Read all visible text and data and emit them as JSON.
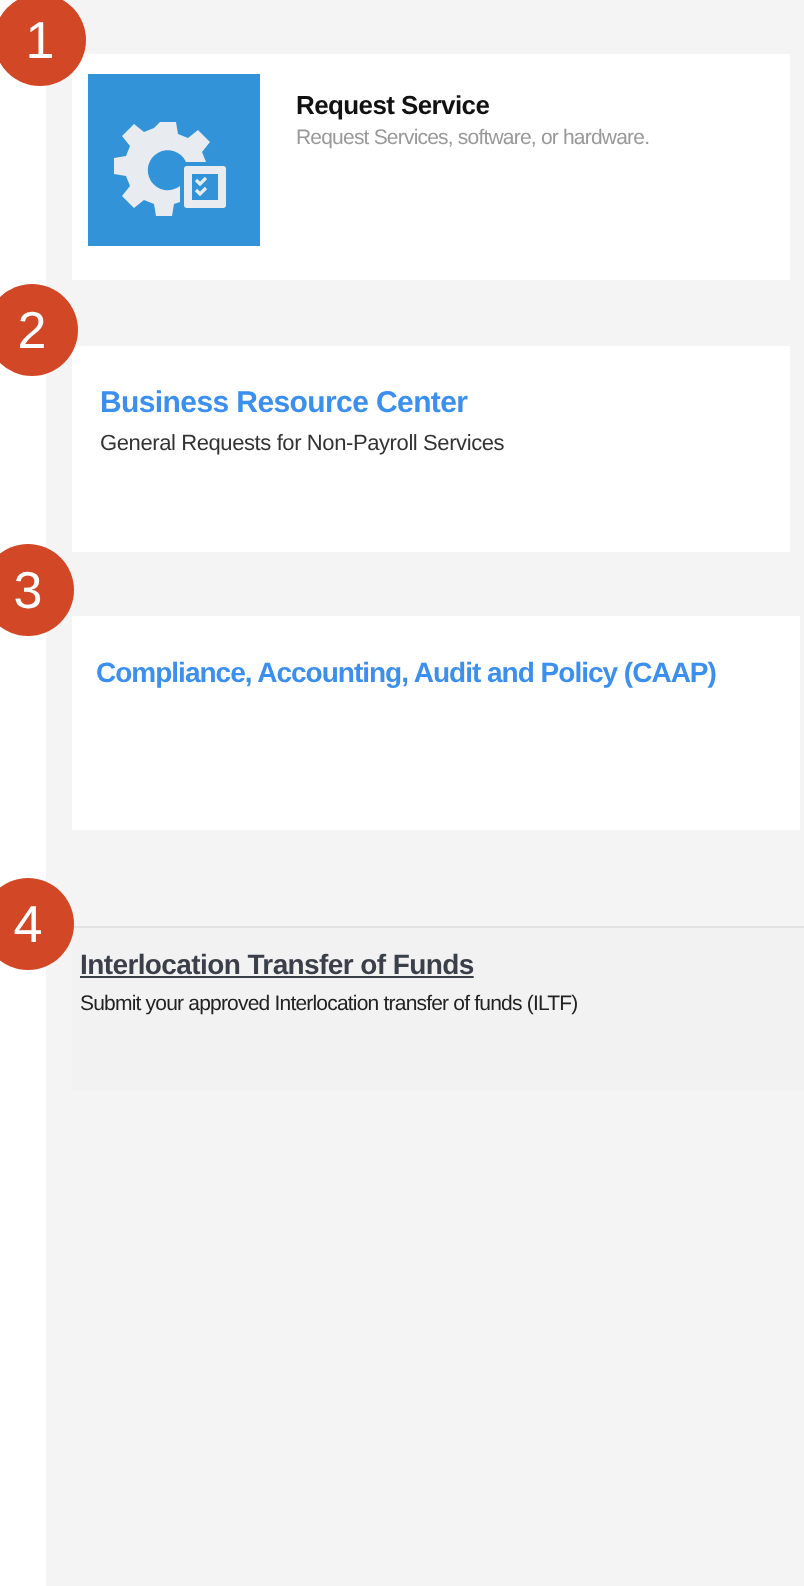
{
  "callouts": [
    "1",
    "2",
    "3",
    "4"
  ],
  "cards": [
    {
      "kind": "service",
      "title": "Request Service",
      "description": "Request Services, software, or hardware."
    },
    {
      "kind": "link",
      "title": "Business Resource Center",
      "description": "General Requests for Non-Payroll Services"
    },
    {
      "kind": "link",
      "title": "Compliance, Accounting, Audit and Policy (CAAP)"
    },
    {
      "kind": "underlined",
      "title": "Interlocation Transfer of Funds",
      "description": "Submit your approved Interlocation transfer of funds (ILTF)"
    }
  ]
}
